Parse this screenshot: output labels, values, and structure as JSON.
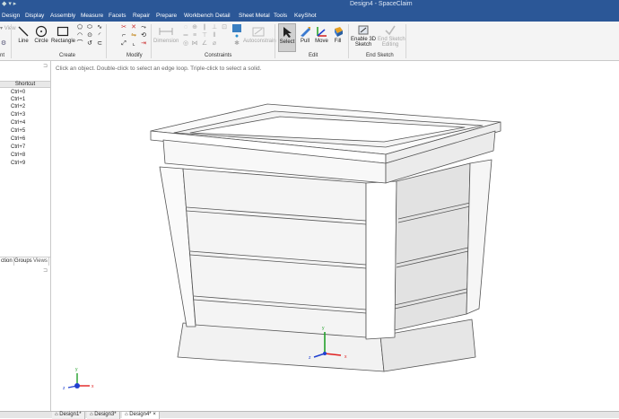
{
  "titlebar": {
    "title": "Design4 - SpaceClaim"
  },
  "menu": [
    "Design",
    "Display",
    "Assembly",
    "Measure",
    "Facets",
    "Repair",
    "Prepare",
    "Workbench",
    "Detail",
    "Sheet Metal",
    "Tools",
    "KeyShot"
  ],
  "ribbon": {
    "clipboard": {
      "view_label": "View",
      "group": "nt"
    },
    "sketch": {
      "line": "Line",
      "circle": "Circle",
      "rectangle": "Rectangle",
      "group": "Create"
    },
    "modify": {
      "group": "Modify"
    },
    "constraints": {
      "dimension": "Dimension",
      "autoconstrain": "Autoconstrain",
      "group": "Constraints"
    },
    "edit": {
      "select": "Select",
      "pull": "Pull",
      "move": "Move",
      "fill": "Fill",
      "group": "Edit"
    },
    "end_sketch": {
      "enable_3d_line1": "Enable 3D",
      "enable_3d_line2": "Sketch",
      "end_line1": "End Sketch",
      "end_line2": "Editing",
      "group": "End Sketch"
    }
  },
  "left_panel": {
    "header": "Shortcut",
    "shortcuts": [
      "Ctrl+0",
      "Ctrl+1",
      "Ctrl+2",
      "Ctrl+3",
      "Ctrl+4",
      "Ctrl+5",
      "Ctrl+6",
      "Ctrl+7",
      "Ctrl+8",
      "Ctrl+9"
    ],
    "tabs": [
      "ction",
      "Groups",
      "Views"
    ]
  },
  "viewport": {
    "hint": "Click an object. Double-click to select an edge loop. Triple-click to select a solid.",
    "triad_center": {
      "x": "x",
      "y": "y",
      "z": "z"
    },
    "triad_corner": {
      "x": "x",
      "y": "y",
      "z": "z"
    }
  },
  "doc_tabs": [
    "Design1*",
    "Design3*",
    "Design4*"
  ],
  "colors": {
    "title_bar": "#2b5797",
    "ribbon": "#f4f4f4",
    "axis_x": "#e02020",
    "axis_y": "#22a02a",
    "axis_z": "#2040d0",
    "model_edge": "#555555"
  }
}
